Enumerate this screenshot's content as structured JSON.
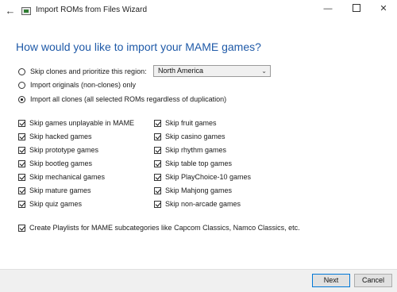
{
  "window": {
    "title": "Import ROMs from Files Wizard",
    "back_icon": "arrow-left-icon",
    "minimize_glyph": "—",
    "close_glyph": "✕"
  },
  "heading": "How would you like to import your MAME games?",
  "import_options": [
    {
      "label": "Skip clones and prioritize this region:",
      "selected": false
    },
    {
      "label": "Import originals (non-clones) only",
      "selected": false
    },
    {
      "label": "Import all clones (all selected ROMs regardless of duplication)",
      "selected": true
    }
  ],
  "region_select": {
    "value": "North America",
    "caret": "⌄"
  },
  "skip_left": [
    {
      "label": "Skip games unplayable in MAME",
      "checked": true
    },
    {
      "label": "Skip hacked games",
      "checked": true
    },
    {
      "label": "Skip prototype games",
      "checked": true
    },
    {
      "label": "Skip bootleg games",
      "checked": true
    },
    {
      "label": "Skip mechanical games",
      "checked": true
    },
    {
      "label": "Skip mature games",
      "checked": true
    },
    {
      "label": "Skip quiz games",
      "checked": true
    }
  ],
  "skip_right": [
    {
      "label": "Skip fruit games",
      "checked": true
    },
    {
      "label": "Skip casino games",
      "checked": true
    },
    {
      "label": "Skip rhythm games",
      "checked": true
    },
    {
      "label": "Skip table top games",
      "checked": true
    },
    {
      "label": "Skip PlayChoice-10 games",
      "checked": true
    },
    {
      "label": "Skip Mahjong games",
      "checked": true
    },
    {
      "label": "Skip non-arcade games",
      "checked": true
    }
  ],
  "playlists_option": {
    "label": "Create Playlists for MAME subcategories like Capcom Classics, Namco Classics, etc.",
    "checked": true
  },
  "footer": {
    "next_label": "Next",
    "cancel_label": "Cancel"
  }
}
